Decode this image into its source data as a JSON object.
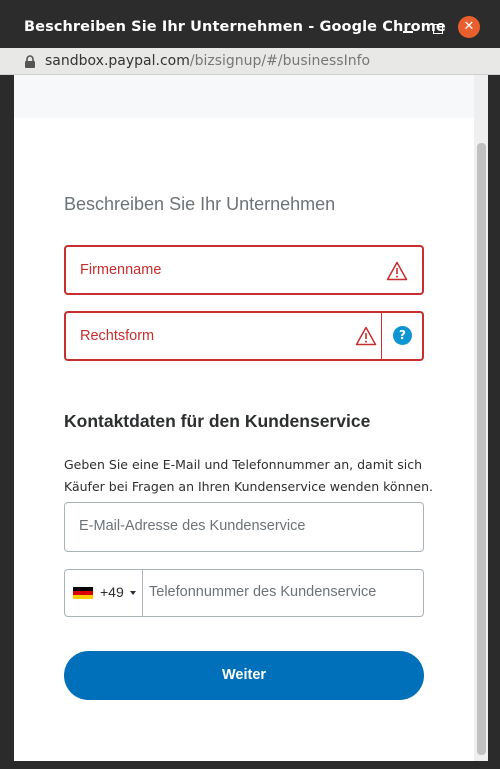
{
  "window": {
    "title": "Beschreiben Sie Ihr Unternehmen - Google Chrome",
    "minimize_icon": "minimize-icon",
    "maximize_icon": "maximize-icon",
    "close_icon": "close-icon",
    "close_glyph": "✕"
  },
  "address_bar": {
    "host": "sandbox.paypal.com",
    "path": "/bizsignup/#/businessInfo"
  },
  "form": {
    "heading": "Beschreiben Sie Ihr Unternehmen",
    "company_name": {
      "label": "Firmenname",
      "state": "error"
    },
    "legal_form": {
      "label": "Rechtsform",
      "state": "error",
      "help_glyph": "?"
    },
    "contact_section": {
      "title": "Kontaktdaten für den Kundenservice",
      "description": "Geben Sie eine E-Mail und Telefonnummer an, damit sich Käufer bei Fragen an Ihren Kundenservice wenden können.",
      "email_placeholder": "E-Mail-Adresse des Kundenservice",
      "phone": {
        "country": "DE",
        "dial_code": "+49",
        "placeholder": "Telefonnummer des Kundenservice"
      }
    },
    "submit_label": "Weiter"
  },
  "colors": {
    "error": "#c72e2e",
    "primary_button": "#0070ba",
    "help_icon": "#0d96d3",
    "close_button": "#e85e2d"
  }
}
